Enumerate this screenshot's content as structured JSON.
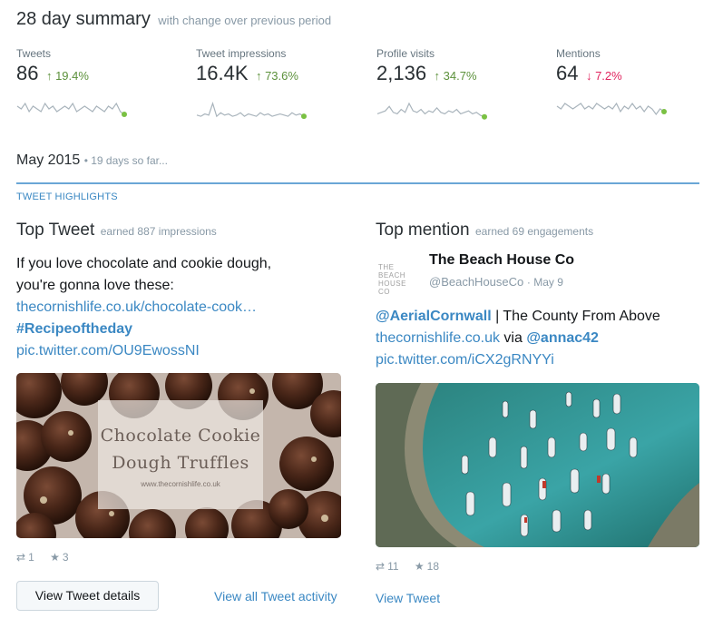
{
  "summary": {
    "title": "28 day summary",
    "subtitle": "with change over previous period",
    "metrics": [
      {
        "label": "Tweets",
        "value": "86",
        "arrow": "↑",
        "change": "19.4%",
        "direction": "up",
        "spark": [
          5,
          4,
          6,
          3,
          5,
          4,
          3,
          6,
          4,
          5,
          3,
          4,
          5,
          4,
          6,
          3,
          4,
          5,
          4,
          3,
          5,
          4,
          3,
          5,
          4,
          6,
          3,
          2
        ]
      },
      {
        "label": "Tweet impressions",
        "value": "16.4K",
        "arrow": "↑",
        "change": "73.6%",
        "direction": "up",
        "spark": [
          4,
          3,
          5,
          4,
          14,
          3,
          6,
          4,
          5,
          3,
          4,
          6,
          3,
          5,
          4,
          3,
          6,
          4,
          5,
          3,
          4,
          5,
          4,
          3,
          6,
          4,
          5,
          3
        ]
      },
      {
        "label": "Profile visits",
        "value": "2,136",
        "arrow": "↑",
        "change": "34.7%",
        "direction": "up",
        "spark": [
          4,
          5,
          6,
          9,
          5,
          4,
          7,
          5,
          11,
          6,
          5,
          7,
          4,
          6,
          5,
          8,
          5,
          4,
          6,
          5,
          7,
          4,
          5,
          6,
          4,
          5,
          3,
          2
        ]
      },
      {
        "label": "Mentions",
        "value": "64",
        "arrow": "↓",
        "change": "7.2%",
        "direction": "down",
        "spark": [
          5,
          4,
          6,
          5,
          4,
          5,
          6,
          4,
          5,
          4,
          6,
          5,
          4,
          5,
          4,
          6,
          3,
          5,
          4,
          6,
          4,
          5,
          3,
          5,
          4,
          2,
          4,
          3
        ]
      }
    ]
  },
  "month": {
    "title": "May 2015",
    "subtitle": "• 19 days so far..."
  },
  "highlights_label": "TWEET HIGHLIGHTS",
  "top_tweet": {
    "heading": "Top Tweet",
    "earned": "earned 887 impressions",
    "line1": "If you love chocolate and cookie dough,",
    "line2": "you're gonna love these:",
    "link": "thecornishlife.co.uk/chocolate-cook…",
    "hashtag": "#Recipeoftheday",
    "pic": "pic.twitter.com/OU9EwossNI",
    "image_title_1": "Chocolate Cookie",
    "image_title_2": "Dough Truffles",
    "image_site": "www.thecornishlife.co.uk",
    "retweets": "1",
    "favorites": "3",
    "details_button": "View Tweet details",
    "activity_link": "View all Tweet activity"
  },
  "top_mention": {
    "heading": "Top mention",
    "earned": "earned 69 engagements",
    "logo_text_1": "THE BEACH",
    "logo_text_2": "HOUSE CO",
    "name": "The Beach House Co",
    "handle": "@BeachHouseCo",
    "date": "· May 9",
    "mention": "@AerialCornwall",
    "text1": " | The County From Above",
    "link": "thecornishlife.co.uk",
    "via": " via ",
    "via_handle": "@annac42",
    "pic": "pic.twitter.com/iCX2gRNYYi",
    "retweets": "11",
    "favorites": "18",
    "view_link": "View Tweet"
  },
  "colors": {
    "accent": "#3b88c3",
    "up": "#5c913b",
    "down": "#e0245e",
    "spark_line": "#a9b4bc",
    "spark_dot": "#7ac143"
  }
}
